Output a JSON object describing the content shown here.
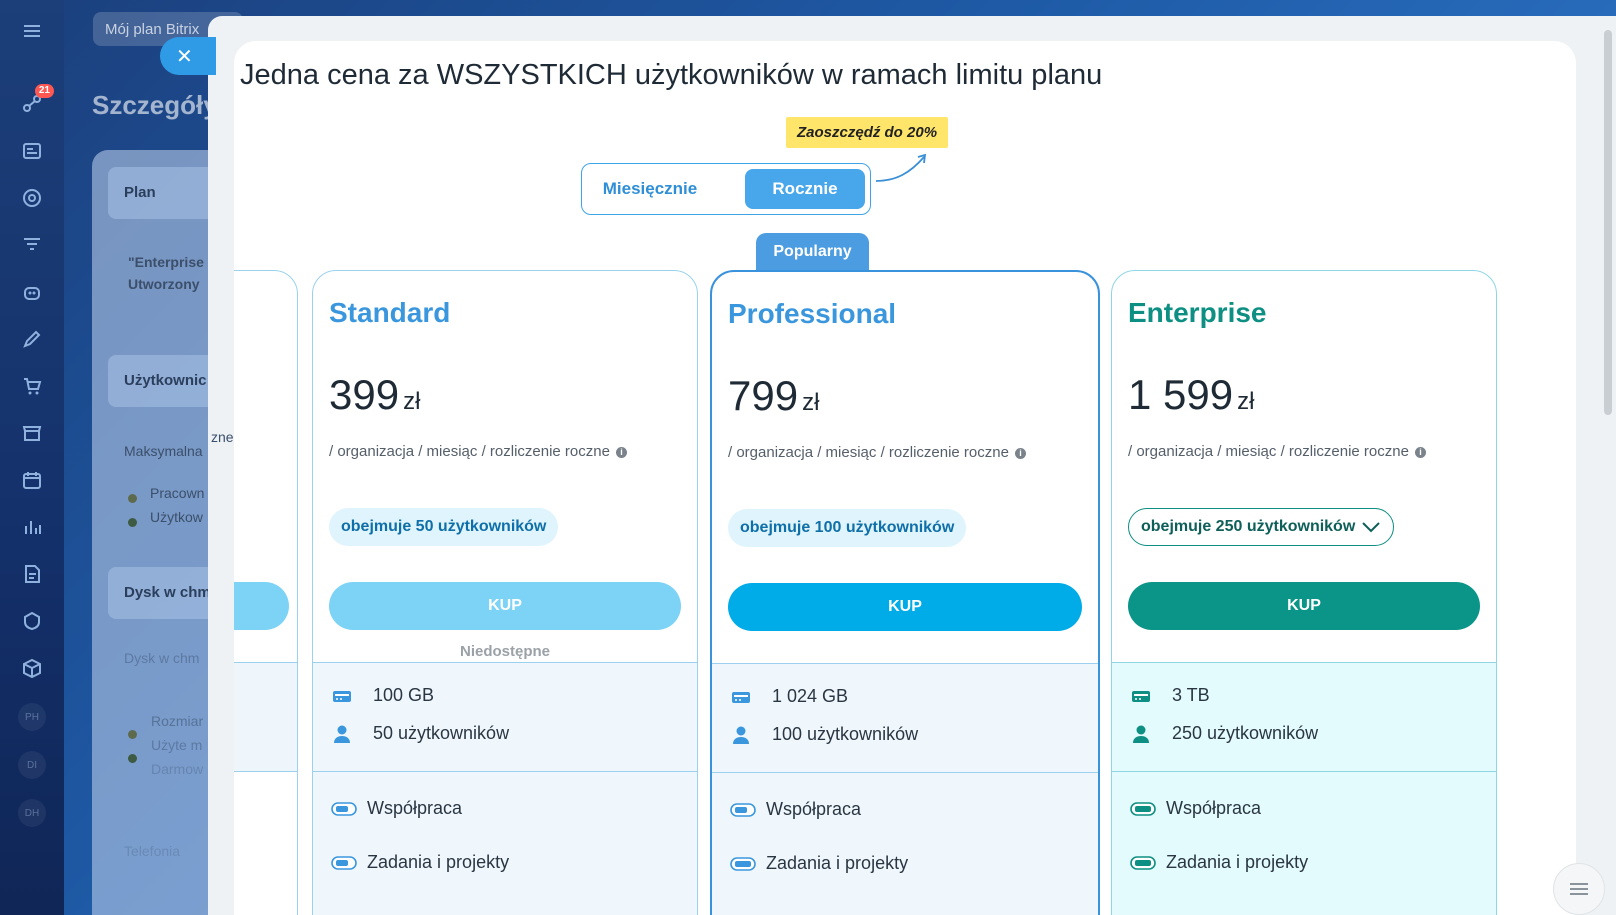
{
  "sidebar": {
    "notification_count": "21",
    "items": [
      "menu-icon",
      "activity-icon",
      "crm-icon",
      "target-icon",
      "funnel-icon",
      "robot-icon",
      "pen-icon",
      "cart-icon",
      "store-icon",
      "calendar-icon",
      "analytics-icon",
      "document-icon",
      "shield-icon",
      "box-icon"
    ],
    "text_icons": [
      "PH",
      "DI",
      "DH"
    ]
  },
  "background": {
    "search_placeholder": "Mój plan Bitrix",
    "page_title": "Szczegóły",
    "section_plan": "Plan",
    "plan_text_1": "\"Enterprise",
    "plan_text_2": "Utworzony",
    "section_users": "Użytkownic",
    "max_label": "Maksymalna",
    "max_label_tail": "zne",
    "user_row_1": "Pracown",
    "user_row_2": "Użytkow",
    "section_disk": "Dysk w chm",
    "disk_label": "Dysk w chm",
    "disk_row_1": "Rozmiar",
    "disk_row_2": "Użyte m",
    "disk_row_3": "Darmow",
    "telephony": "Telefonia"
  },
  "modal": {
    "heading": "Jedna cena za WSZYSTKICH użytkowników w ramach limitu planu",
    "save_badge": "Zaoszczędź do 20%",
    "billing": {
      "monthly_label": "Miesięcznie",
      "yearly_label": "Rocznie",
      "selected": "Rocznie"
    },
    "popular_label": "Popularny",
    "unavailable_label": "Niedostępne",
    "plans": [
      {
        "name": "Standard",
        "price": "399",
        "currency": "zł",
        "period": "/ organizacja / miesiąc / rozliczenie roczne",
        "users_pill": "obejmuje 50 użytkowników",
        "buy_label": "KUP",
        "storage": "100 GB",
        "users": "50 użytkowników",
        "features": [
          "Współpraca",
          "Zadania i projekty"
        ],
        "color": "#3b97dd",
        "button_color": "#7dd3f6"
      },
      {
        "name": "Professional",
        "price": "799",
        "currency": "zł",
        "period": "/ organizacja / miesiąc / rozliczenie roczne",
        "users_pill": "obejmuje 100 użytkowników",
        "buy_label": "KUP",
        "storage": "1 024 GB",
        "users": "100 użytkowników",
        "features": [
          "Współpraca",
          "Zadania i projekty"
        ],
        "color": "#3b97dd",
        "button_color": "#00ace8"
      },
      {
        "name": "Enterprise",
        "price": "1 599",
        "currency": "zł",
        "period": "/ organizacja / miesiąc / rozliczenie roczne",
        "users_pill": "obejmuje 250 użytkowników",
        "buy_label": "KUP",
        "storage": "3 TB",
        "users": "250 użytkowników",
        "features": [
          "Współpraca",
          "Zadania i projekty"
        ],
        "color": "#0e8f83",
        "button_color": "#0b9488"
      }
    ]
  }
}
